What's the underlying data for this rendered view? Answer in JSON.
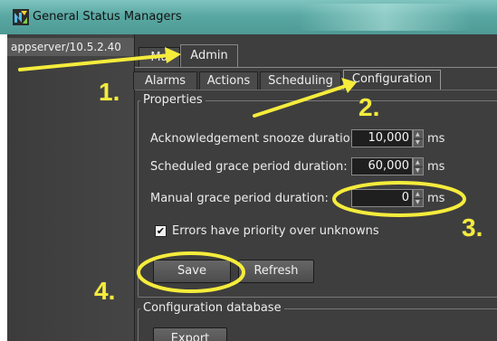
{
  "window": {
    "title": "General Status Managers"
  },
  "sidebar": {
    "items": [
      {
        "label": "appserver/10.5.2.40"
      }
    ]
  },
  "outer_tabs": [
    {
      "label": "Ma"
    },
    {
      "label": "Admin"
    }
  ],
  "inner_tabs": [
    {
      "label": "Alarms"
    },
    {
      "label": "Actions"
    },
    {
      "label": "Scheduling"
    },
    {
      "label": "Configuration"
    }
  ],
  "properties": {
    "title": "Properties",
    "ack_snooze": {
      "label": "Acknowledgement snooze duration:",
      "value": "10,000",
      "unit": "ms"
    },
    "scheduled_grace": {
      "label": "Scheduled grace period duration:",
      "value": "60,000",
      "unit": "ms"
    },
    "manual_grace": {
      "label": "Manual grace period duration:",
      "value": "0",
      "unit": "ms"
    },
    "errors_priority": {
      "label": "Errors have priority over unknowns",
      "checked": true,
      "mark": "✔"
    },
    "save_label": "Save",
    "refresh_label": "Refresh"
  },
  "config_db": {
    "title": "Configuration database",
    "export_label": "Export"
  },
  "annotations": {
    "step1": "1.",
    "step2": "2.",
    "step3": "3.",
    "step4": "4."
  },
  "colors": {
    "annotation": "#f5ec3c",
    "titlebar": "#5aa8a3"
  }
}
